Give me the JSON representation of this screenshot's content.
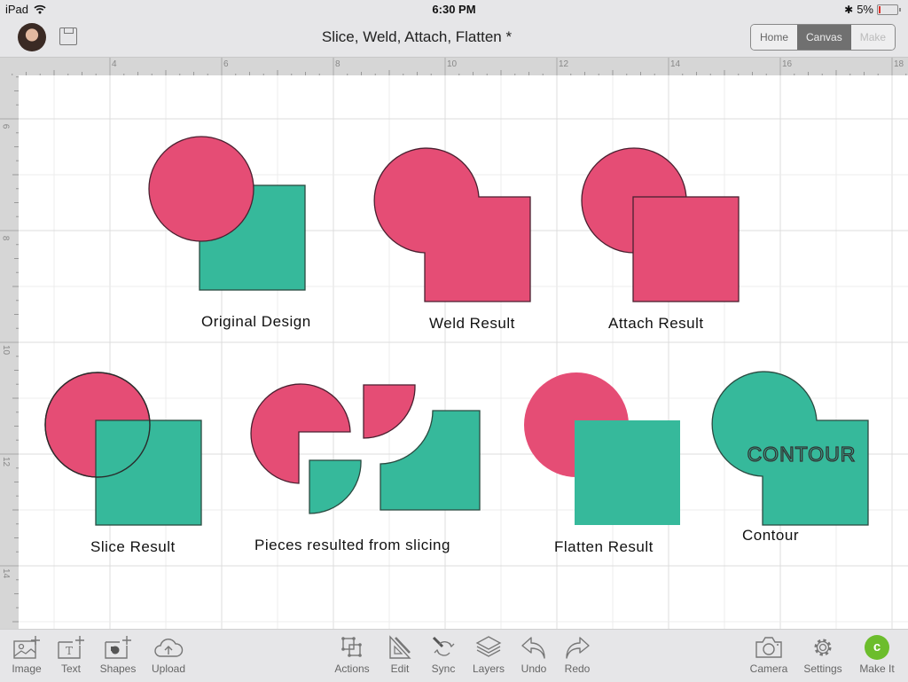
{
  "status_bar": {
    "device": "iPad",
    "time": "6:30 PM",
    "battery": "5%"
  },
  "nav": {
    "title": "Slice, Weld, Attach, Flatten *",
    "segments": [
      {
        "label": "Home",
        "state": "normal"
      },
      {
        "label": "Canvas",
        "state": "active"
      },
      {
        "label": "Make",
        "state": "disabled"
      }
    ]
  },
  "rulers": {
    "horizontal": [
      "4",
      "6",
      "8",
      "10",
      "12",
      "14",
      "16",
      "18"
    ],
    "vertical": [
      "6",
      "8",
      "10",
      "12",
      "14"
    ]
  },
  "canvas": {
    "colors": {
      "pink": "#e54d75",
      "teal": "#36b99b",
      "outline": "#4a2030"
    },
    "labels": {
      "original": "Original Design",
      "weld": "Weld Result",
      "attach": "Attach Result",
      "slice": "Slice Result",
      "pieces": "Pieces resulted from slicing",
      "flatten": "Flatten Result",
      "contour": "Contour",
      "contour_text": "CONTOUR"
    }
  },
  "toolbar": {
    "left": [
      {
        "label": "Image",
        "icon": "image-add-icon"
      },
      {
        "label": "Text",
        "icon": "text-add-icon"
      },
      {
        "label": "Shapes",
        "icon": "shapes-add-icon"
      },
      {
        "label": "Upload",
        "icon": "cloud-upload-icon"
      }
    ],
    "center": [
      {
        "label": "Actions",
        "icon": "actions-icon"
      },
      {
        "label": "Edit",
        "icon": "edit-icon"
      },
      {
        "label": "Sync",
        "icon": "sync-icon"
      },
      {
        "label": "Layers",
        "icon": "layers-icon"
      },
      {
        "label": "Undo",
        "icon": "undo-icon"
      },
      {
        "label": "Redo",
        "icon": "redo-icon"
      }
    ],
    "right": [
      {
        "label": "Camera",
        "icon": "camera-icon"
      },
      {
        "label": "Settings",
        "icon": "settings-icon"
      },
      {
        "label": "Make It",
        "icon": "make-it-icon"
      }
    ]
  }
}
